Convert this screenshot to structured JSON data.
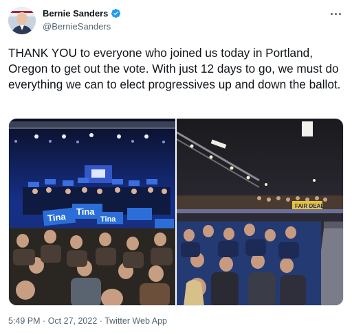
{
  "author": {
    "display_name": "Bernie Sanders",
    "handle": "@BernieSanders",
    "verified": true
  },
  "tweet": {
    "text": "THANK YOU to everyone who joined us today in Portland, Oregon to get out the vote. With just 12 days to go, we must do everything we can to elect progressives up and down the ballot."
  },
  "media": {
    "left_photo": {
      "signs": [
        "Tina",
        "Tina",
        "Tina"
      ]
    },
    "right_photo": {
      "banner": "FAIR DEAL"
    }
  },
  "meta": {
    "time": "5:49 PM",
    "separator": "·",
    "date": "Oct 27, 2022",
    "source": "Twitter Web App"
  },
  "colors": {
    "verified_blue": "#1d9bf0",
    "text_primary": "#0f1419",
    "text_secondary": "#536471"
  },
  "icons": [
    "verified-badge-icon",
    "more-options-icon"
  ]
}
